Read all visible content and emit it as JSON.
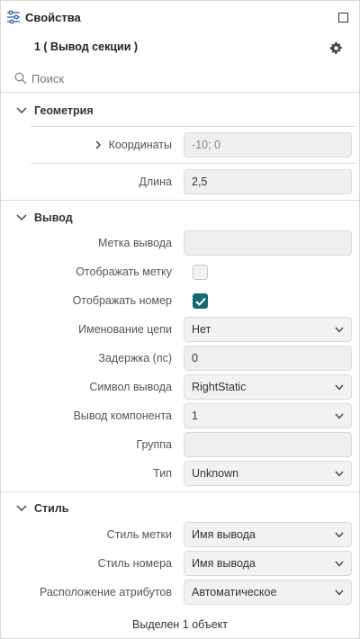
{
  "header": {
    "title": "Свойства",
    "icon": "sliders-icon",
    "maximize_icon": "maximize-icon"
  },
  "object": {
    "title": "1 ( Вывод секции )",
    "settings_icon": "gear-icon"
  },
  "search": {
    "placeholder": "Поиск",
    "value": ""
  },
  "sections": {
    "geometry": {
      "title": "Геометрия",
      "coordinates": {
        "label": "Координаты",
        "value": "-10; 0"
      },
      "length": {
        "label": "Длина",
        "value": "2,5"
      }
    },
    "pin": {
      "title": "Вывод",
      "pin_label": {
        "label": "Метка вывода",
        "value": ""
      },
      "show_label": {
        "label": "Отображать метку",
        "checked": false
      },
      "show_number": {
        "label": "Отображать номер",
        "checked": true
      },
      "net_naming": {
        "label": "Именование цепи",
        "value": "Нет"
      },
      "delay": {
        "label": "Задержка (пс)",
        "value": "0"
      },
      "pin_symbol": {
        "label": "Символ вывода",
        "value": "RightStatic"
      },
      "component_pin": {
        "label": "Вывод компонента",
        "value": "1"
      },
      "group": {
        "label": "Группа",
        "value": ""
      },
      "type": {
        "label": "Тип",
        "value": "Unknown"
      }
    },
    "style": {
      "title": "Стиль",
      "label_style": {
        "label": "Стиль метки",
        "value": "Имя вывода"
      },
      "number_style": {
        "label": "Стиль номера",
        "value": "Имя вывода"
      },
      "attr_placement": {
        "label": "Расположение атрибутов",
        "value": "Автоматическое"
      }
    }
  },
  "status": {
    "text": "Выделен 1 объект"
  },
  "colors": {
    "accent": "#136a77",
    "field_bg": "#efefef",
    "border": "#dadada"
  }
}
